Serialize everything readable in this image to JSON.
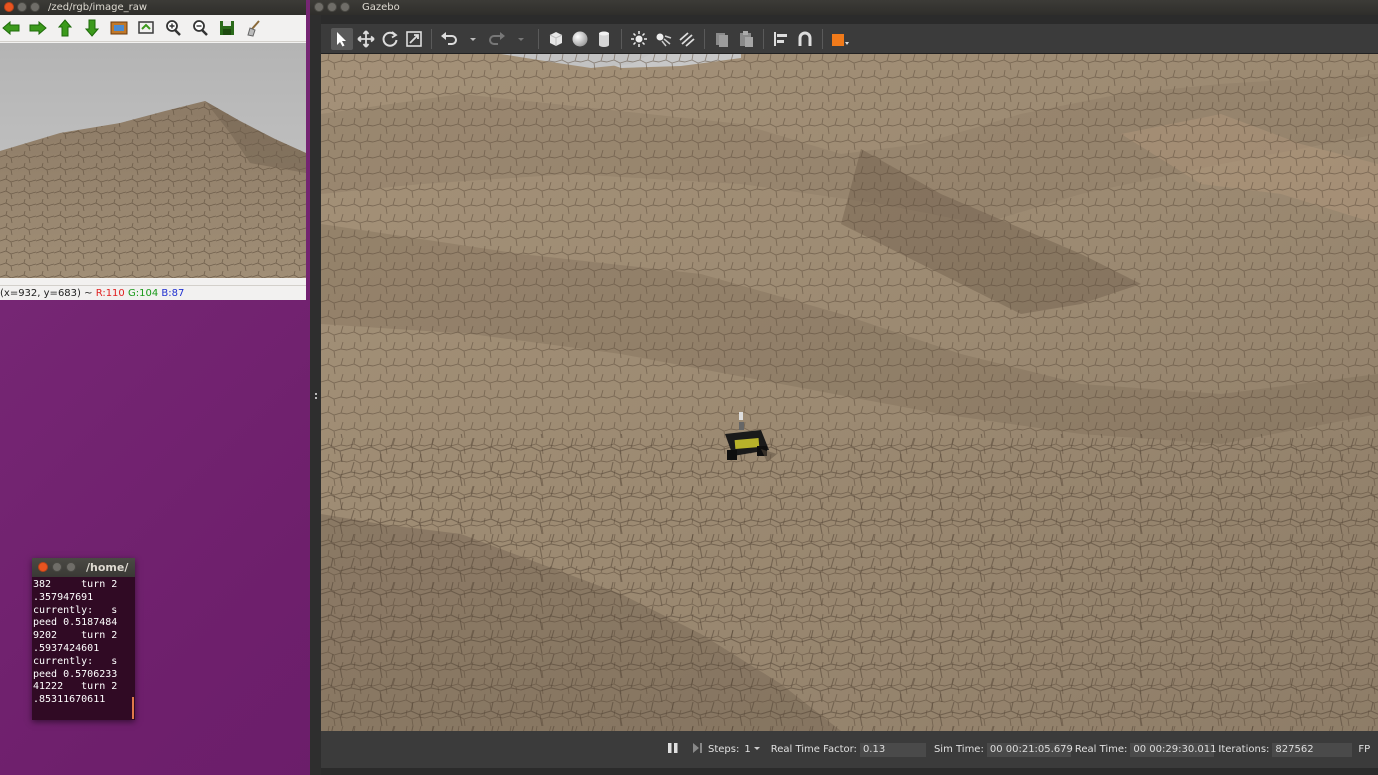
{
  "image_view": {
    "title": "/zed/rgb/image_raw",
    "status_prefix": "(x=932, y=683) ~",
    "status_r": "R:110",
    "status_g": "G:104",
    "status_b": "B:87"
  },
  "terminal": {
    "title": "/home/",
    "lines": "382     turn 2\n.357947691\ncurrently:   s\npeed 0.5187484\n9202    turn 2\n.5937424601\ncurrently:   s\npeed 0.5706233\n41222   turn 2\n.85311670611"
  },
  "gazebo": {
    "title": "Gazebo",
    "toolbar_icons": [
      "select-icon",
      "translate-icon",
      "rotate-icon",
      "scale-icon",
      "undo-icon",
      "undo-dropdown-icon",
      "redo-icon",
      "redo-dropdown-icon",
      "box-icon",
      "sphere-icon",
      "cylinder-icon",
      "point-light-icon",
      "spot-light-icon",
      "directional-light-icon",
      "copy-icon",
      "paste-icon",
      "align-icon",
      "snap-icon",
      "screenshot-icon"
    ],
    "bottom": {
      "steps_label": "Steps:",
      "steps_value": "1",
      "rtf_label": "Real Time Factor:",
      "rtf_value": "0.13",
      "sim_time_label": "Sim Time:",
      "sim_time_value": "00 00:21:05.679",
      "real_time_label": "Real Time:",
      "real_time_value": "00 00:29:30.011",
      "iterations_label": "Iterations:",
      "iterations_value": "827562",
      "fps_label": "FP"
    }
  },
  "colors": {
    "desktop": "#6e1f6c",
    "terrain": "#9c8a72",
    "ubuntu_orange": "#e95420"
  }
}
